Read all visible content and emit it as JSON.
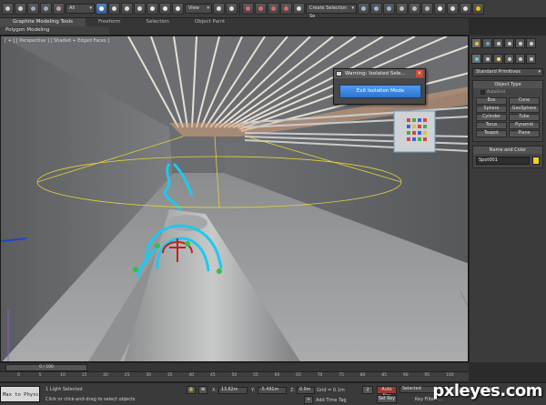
{
  "toolbar": {
    "filter_select": "All",
    "refcoord_select": "View",
    "selection_set": "Create Selection Se"
  },
  "ribbon": {
    "tabs": [
      "Graphite Modeling Tools",
      "Freeform",
      "Selection",
      "Object Paint"
    ],
    "active_tab": "Graphite Modeling Tools",
    "sub_label": "Polygon Modeling"
  },
  "viewport": {
    "label": "[ + ] [ Perspective ] [ Shaded + Edged Faces ]"
  },
  "dialog": {
    "title": "Warning: Isolated Sele...",
    "button": "Exit Isolation Mode"
  },
  "command_panel": {
    "category_select": "Standard Primitives",
    "object_type_header": "Object Type",
    "autogrid_label": "AutoGrid",
    "primitives": [
      "Box",
      "Cone",
      "Sphere",
      "GeoSphere",
      "Cylinder",
      "Tube",
      "Torus",
      "Pyramid",
      "Teapot",
      "Plane"
    ],
    "name_color_header": "Name and Color",
    "object_name": "Spot001",
    "object_color": "#f2d21a"
  },
  "timeline": {
    "frame_counter": "0 / 100",
    "ruler": [
      "0",
      "5",
      "10",
      "15",
      "20",
      "25",
      "30",
      "35",
      "40",
      "45",
      "50",
      "55",
      "60",
      "65",
      "70",
      "75",
      "80",
      "85",
      "90",
      "95",
      "100"
    ]
  },
  "status": {
    "maxscript": "Max to Physc",
    "selected_text": "1 Light Selected",
    "prompt_text": "Click or click-and-drag to select objects",
    "x_label": "X:",
    "x_value": "13.62m",
    "y_label": "Y:",
    "y_value": "-5.491m",
    "z_label": "Z:",
    "z_value": "0.0m",
    "grid_text": "Grid = 0.1m",
    "add_time_tag": "Add Time Tag",
    "auto_key": "Auto Key",
    "set_key": "Set Key",
    "selected_select": "Selected",
    "key_filters": "Key Filters..."
  },
  "watermark": "pxleyes.com"
}
